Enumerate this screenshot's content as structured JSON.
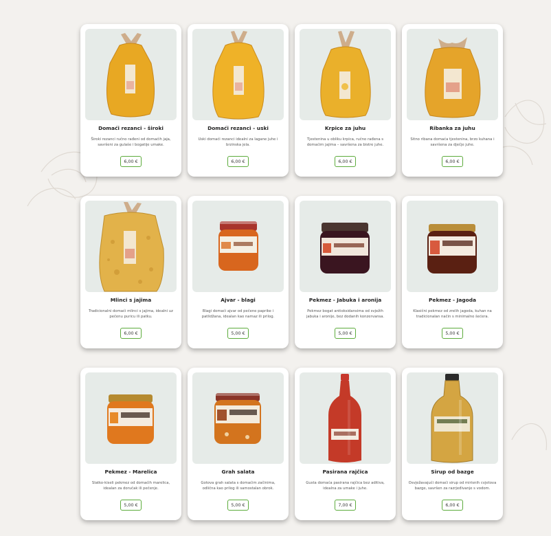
{
  "colors": {
    "background": "#f3f1ee",
    "card": "#ffffff",
    "image_bg": "#e6ebe8",
    "price_border": "#5cab3b"
  },
  "currency": "€",
  "products": [
    {
      "name": "Domaći rezanci - široki",
      "description": "Široki rezanci ručno rađeni od domaćih jaja, savršeni za gulaše i bogatije umake.",
      "price": "6,00 €",
      "icon": "noodles-bag-icon"
    },
    {
      "name": "Domaći rezanci - uski",
      "description": "Uski domaći rezanci idealni za lagane juhe i brzinska jela.",
      "price": "6,00 €",
      "icon": "noodles-bag-icon"
    },
    {
      "name": "Krpice za juhu",
      "description": "Tjestenina u obliku krpica, ručno rađena s domaćim jajima – savršena za bistre juhe.",
      "price": "6,00 €",
      "icon": "noodles-bag-icon"
    },
    {
      "name": "Ribanka za juhu",
      "description": "Sitno ribana domaća tjestenina, brzo kuhana i savršena za dječje juhe.",
      "price": "6,00 €",
      "icon": "noodles-bag-icon"
    },
    {
      "name": "Mlinci s jajima",
      "description": "Tradicionalni domaći mlinci s jajima, idealni uz pečenu puricu ili patku.",
      "price": "6,00 €",
      "icon": "mlinci-bag-icon"
    },
    {
      "name": "Ajvar - blagi",
      "description": "Blagi domaći ajvar od pečene paprike i patlidžana, idealan kao namaz ili prilog.",
      "price": "5,00 €",
      "icon": "jar-icon"
    },
    {
      "name": "Pekmez - Jabuka i aronija",
      "description": "Pekmez bogat antioksidansima od svježih jabuka i aronije, bez dodanih konzervansa.",
      "price": "5,00 €",
      "icon": "jar-icon"
    },
    {
      "name": "Pekmez - Jagoda",
      "description": "Klasični pekmez od zrelih jagoda, kuhan na tradicionalan način s minimalno šećera.",
      "price": "5,00 €",
      "icon": "jar-icon"
    },
    {
      "name": "Pekmez - Marelica",
      "description": "Slatko-kiseli pekmez od domaćih marelica, idealan za doručak ili pečenje.",
      "price": "5,00 €",
      "icon": "jar-icon"
    },
    {
      "name": "Grah salata",
      "description": "Gotova grah salata s domaćim začinima, odlična kao prilog ili samostalan obrok.",
      "price": "5,00 €",
      "icon": "jar-icon"
    },
    {
      "name": "Pasirana rajčica",
      "description": "Gusta domaća pasirana rajčica bez aditiva, idealna za umake i juhe.",
      "price": "7,00 €",
      "icon": "bottle-icon"
    },
    {
      "name": "Sirup od bazge",
      "description": "Osvježavajući domaći sirup od mirisnih cvjetova bazge, savršen za razrjeđivanje s vodom.",
      "price": "6,00 €",
      "icon": "bottle-icon"
    }
  ]
}
